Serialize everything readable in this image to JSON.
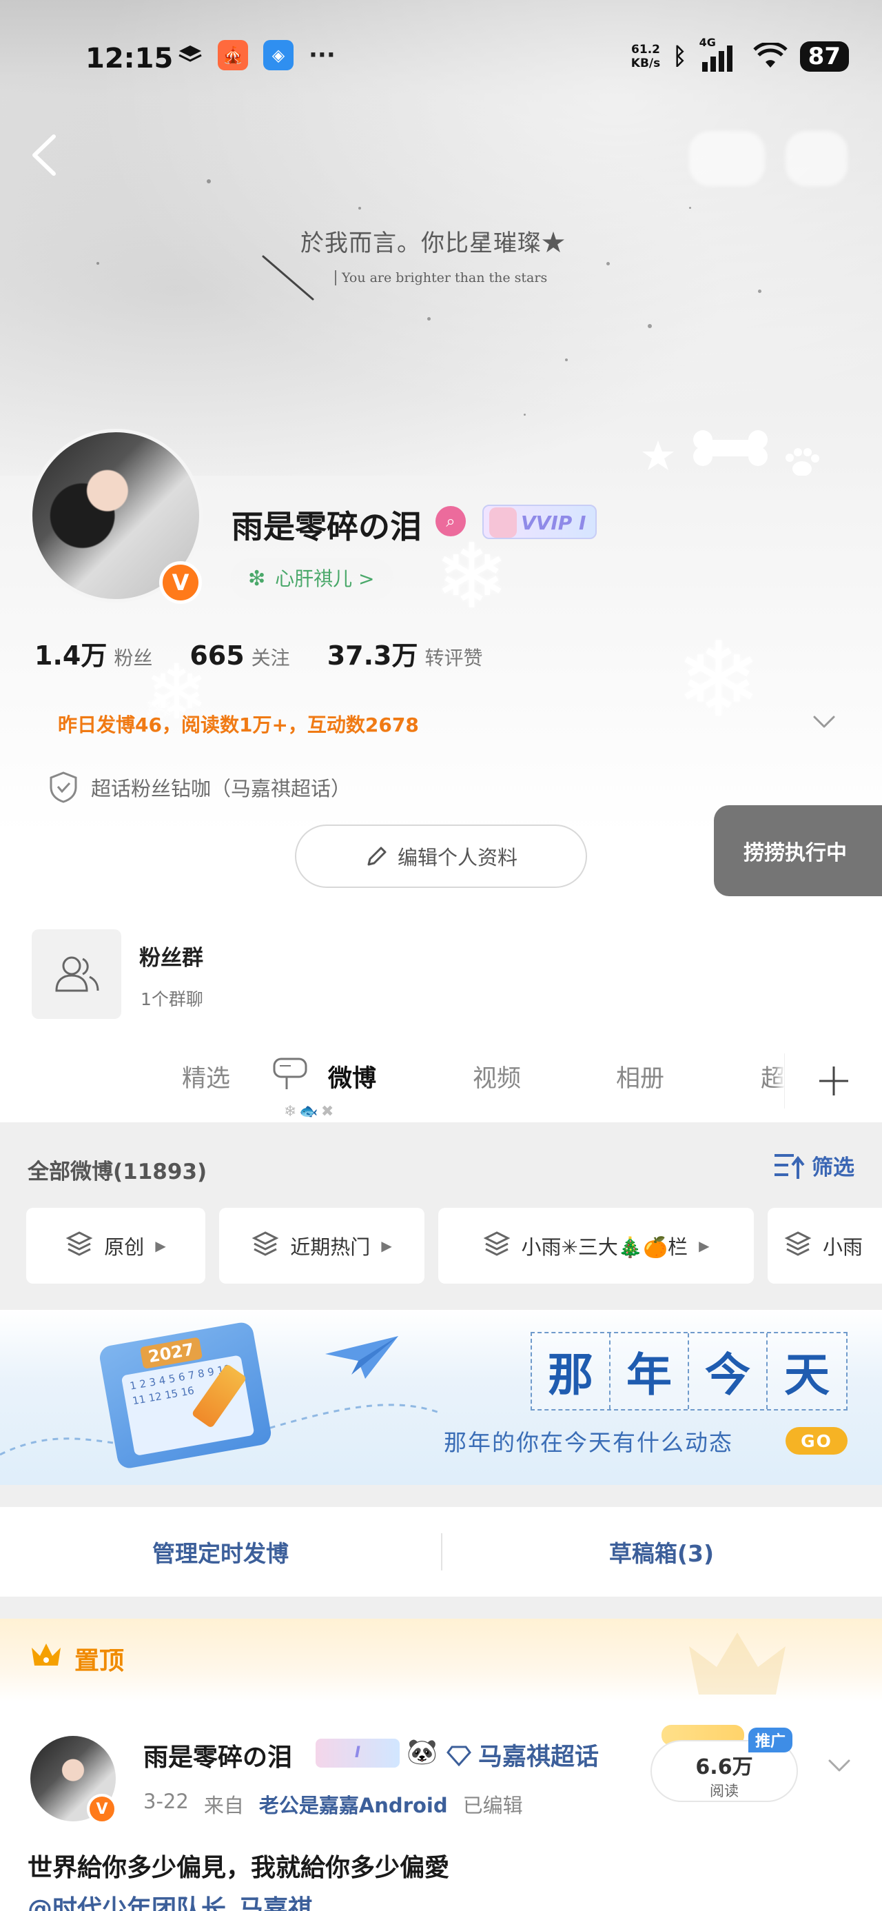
{
  "status_bar": {
    "time": "12:15",
    "net_speed_value": "61.2",
    "net_speed_unit": "KB/s",
    "signal_type": "4G",
    "battery": "87"
  },
  "cover": {
    "quote": "於我而言。你比星璀璨★",
    "subquote": "You are brighter than the stars"
  },
  "profile": {
    "username": "雨是零碎の泪",
    "vip_label": "VVIP I",
    "group_chip": "心肝祺儿 >",
    "stats": [
      {
        "num": "1.4万",
        "label": "粉丝"
      },
      {
        "num": "665",
        "label": "关注"
      },
      {
        "num": "37.3万",
        "label": "转评赞"
      }
    ],
    "yesterday_summary": "昨日发博46，阅读数1万+，互动数2678",
    "super_fan": "超话粉丝钻咖（马嘉祺超话）",
    "edit_button": "编辑个人资料",
    "floating_button": "捞捞执行中"
  },
  "fans_group": {
    "title": "粉丝群",
    "subtitle": "1个群聊"
  },
  "tabs": [
    "精选",
    "微博",
    "视频",
    "相册",
    "超"
  ],
  "active_tab": "微博",
  "feed_header": {
    "all_label": "全部微博(11893)",
    "filter_label": "筛选"
  },
  "filter_chips": [
    {
      "label": "原创"
    },
    {
      "label": "近期热门"
    },
    {
      "label": "小雨✳三大🎄🍊栏"
    },
    {
      "label": "小雨"
    }
  ],
  "banner": {
    "calendar_year": "2027",
    "calendar_days": "1 2 3 4 5 6 7 8 9 10 11 12 15 16",
    "title_chars": [
      "那",
      "年",
      "今",
      "天"
    ],
    "subtitle": "那年的你在今天有什么动态",
    "go_label": "GO"
  },
  "manage": {
    "scheduled": "管理定时发博",
    "drafts": "草稿箱(3)"
  },
  "pinned": {
    "label": "置顶"
  },
  "post": {
    "author": "雨是零碎の泪",
    "badge": "I",
    "topic": "马嘉祺超话",
    "date": "3-22",
    "from_label": "来自",
    "source": "老公是嘉嘉Android",
    "edited": "已编辑",
    "reads_num": "6.6万",
    "reads_label": "阅读",
    "promo": "推广",
    "text": "世界給你多少偏見，我就給你多少偏愛",
    "mention": "@时代少年团队长_马嘉祺"
  },
  "colors": {
    "accent_orange": "#f07a14",
    "link_blue": "#3c5f9a",
    "verify_orange": "#ff7a1a",
    "green": "#4aa86a"
  }
}
